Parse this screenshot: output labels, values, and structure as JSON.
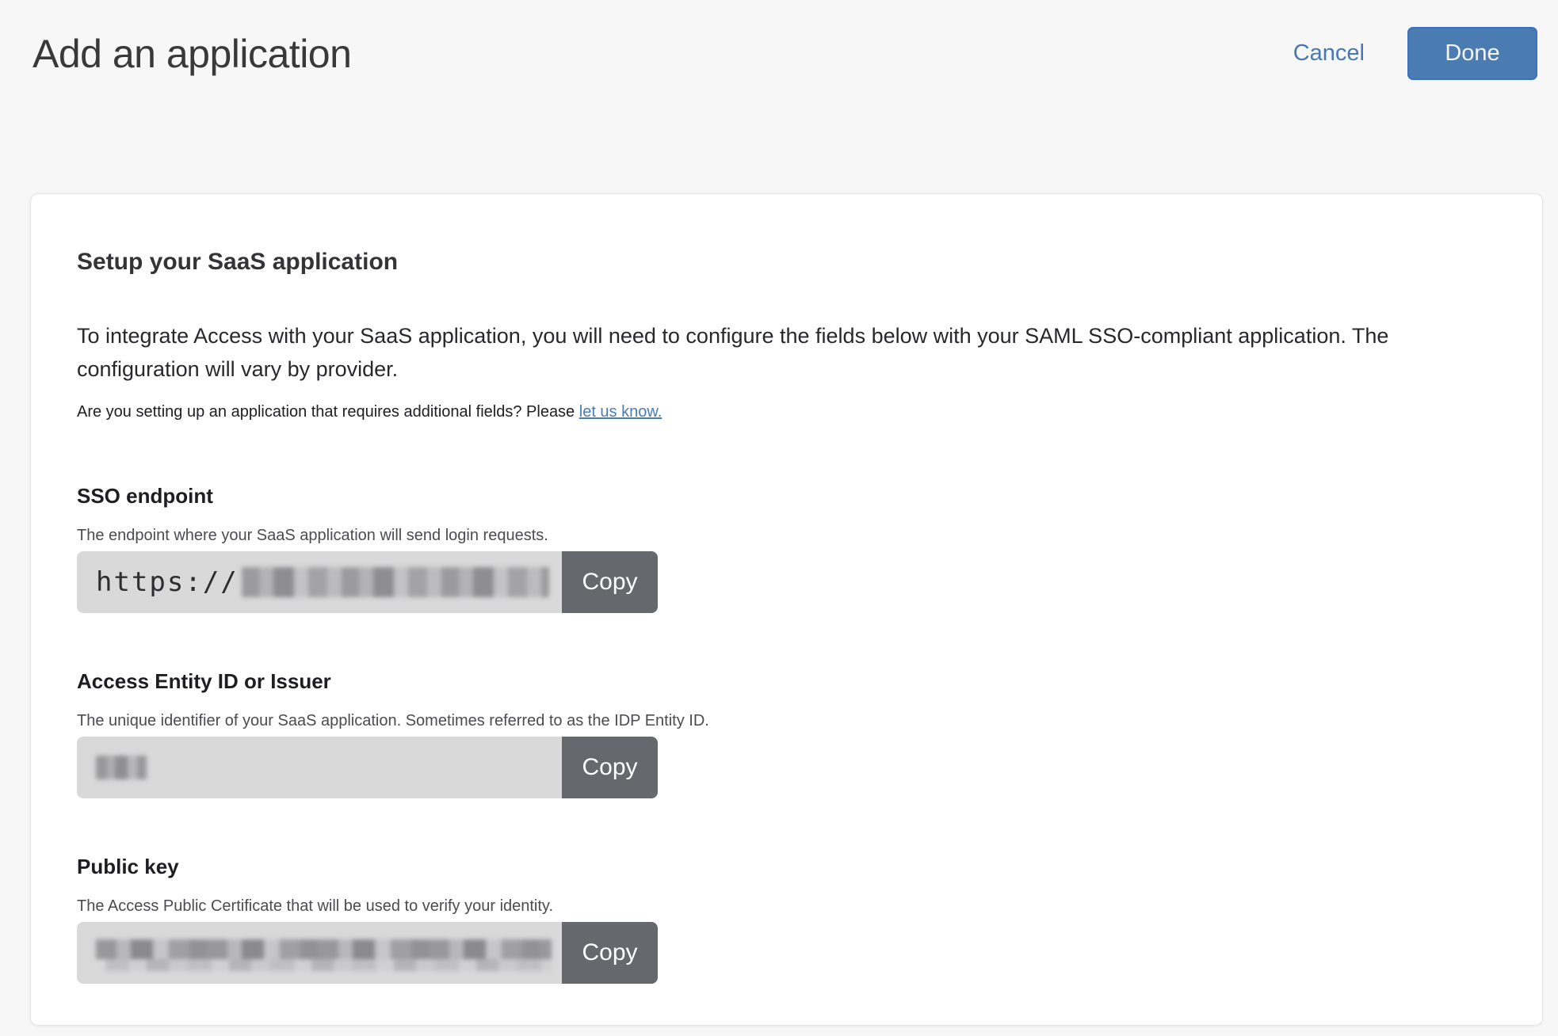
{
  "header": {
    "title": "Add an application",
    "cancel_label": "Cancel",
    "done_label": "Done"
  },
  "card": {
    "heading": "Setup your SaaS application",
    "intro": "To integrate Access with your SaaS application, you will need to configure the fields below with your SAML SSO-compliant application. The configuration will vary by provider.",
    "note_text": "Are you setting up an application that requires additional fields? Please",
    "note_link": "let us know."
  },
  "fields": [
    {
      "label": "SSO endpoint",
      "description": "The endpoint where your SaaS application will send login requests.",
      "value_prefix": "https://",
      "value_redacted": true,
      "copy_label": "Copy"
    },
    {
      "label": "Access Entity ID or Issuer",
      "description": "The unique identifier of your SaaS application. Sometimes referred to as the IDP Entity ID.",
      "value_prefix": "",
      "value_redacted": true,
      "copy_label": "Copy"
    },
    {
      "label": "Public key",
      "description": "The Access Public Certificate that will be used to verify your identity.",
      "value_prefix": "",
      "value_redacted": true,
      "copy_label": "Copy"
    }
  ],
  "colors": {
    "page_background": "#f7f7f7",
    "card_background": "#ffffff",
    "accent_blue": "#4a7cb2",
    "done_border_blue": "#3c70c4",
    "link_blue": "#4a7cb5",
    "copy_button_gray": "#65696d",
    "field_gray": "#d9d9da"
  }
}
